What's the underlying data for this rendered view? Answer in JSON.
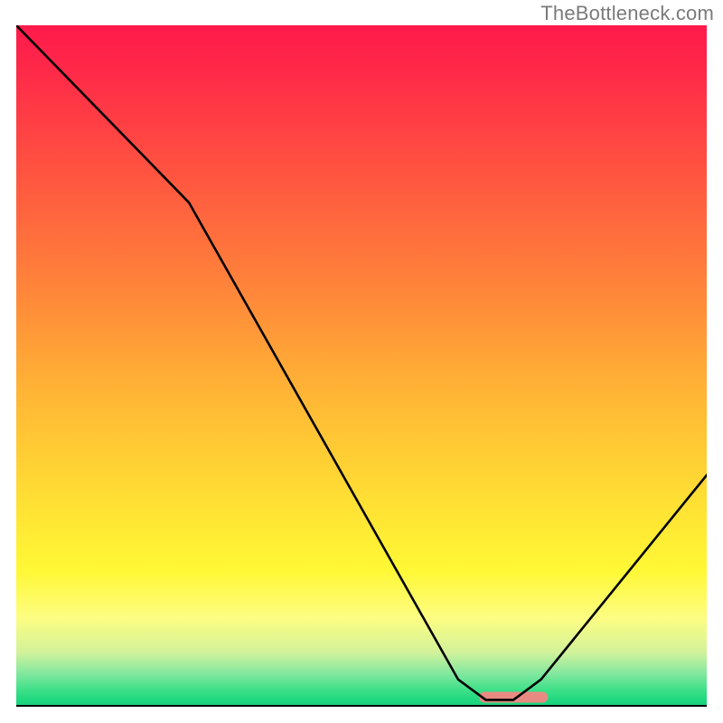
{
  "watermark": "TheBottleneck.com",
  "chart_data": {
    "type": "line",
    "title": "",
    "xlabel": "",
    "ylabel": "",
    "xlim": [
      0,
      100
    ],
    "ylim": [
      0,
      100
    ],
    "grid": false,
    "series": [
      {
        "name": "curve",
        "x": [
          0,
          25,
          64,
          68,
          72,
          76,
          100
        ],
        "values": [
          100,
          74,
          4,
          1,
          1,
          4,
          34
        ]
      }
    ],
    "notes": "V-shaped black curve on red-to-green vertical gradient; small salmon marker at trough near x≈70",
    "trough_marker": {
      "x_start": 67,
      "x_end": 77,
      "y": 1.4,
      "color": "#e88a82"
    },
    "gradient_stops": [
      {
        "pos": 0.0,
        "color": "#ff1a4b"
      },
      {
        "pos": 0.07,
        "color": "#ff2a48"
      },
      {
        "pos": 0.22,
        "color": "#ff5540"
      },
      {
        "pos": 0.38,
        "color": "#ff833a"
      },
      {
        "pos": 0.55,
        "color": "#ffb835"
      },
      {
        "pos": 0.7,
        "color": "#ffe034"
      },
      {
        "pos": 0.8,
        "color": "#fff835"
      },
      {
        "pos": 0.87,
        "color": "#fdfd82"
      },
      {
        "pos": 0.92,
        "color": "#d2f29a"
      },
      {
        "pos": 0.95,
        "color": "#86e8a0"
      },
      {
        "pos": 0.975,
        "color": "#3fe089"
      },
      {
        "pos": 0.99,
        "color": "#1fd880"
      },
      {
        "pos": 1.0,
        "color": "#17d07a"
      }
    ]
  }
}
